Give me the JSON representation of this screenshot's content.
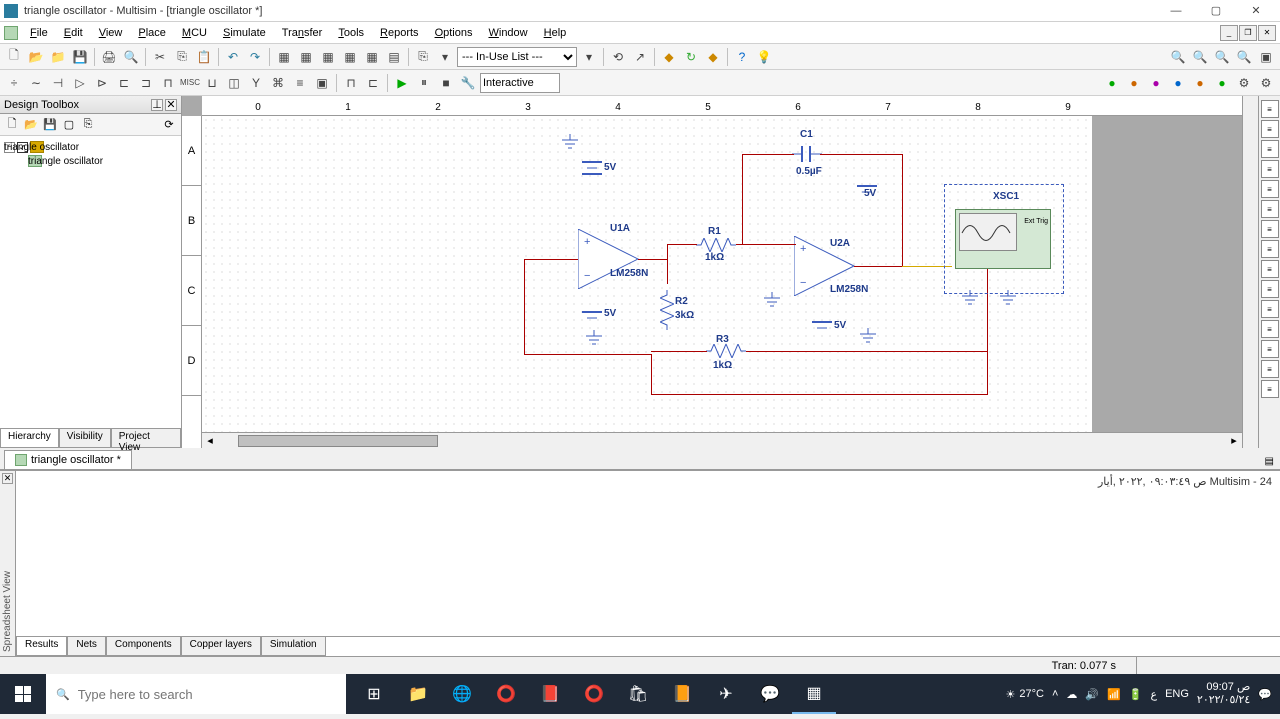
{
  "window": {
    "title": "triangle oscillator - Multisim - [triangle oscillator *]"
  },
  "menu": {
    "file": "File",
    "edit": "Edit",
    "view": "View",
    "place": "Place",
    "mcu": "MCU",
    "simulate": "Simulate",
    "transfer": "Transfer",
    "tools": "Tools",
    "reports": "Reports",
    "options": "Options",
    "window": "Window",
    "help": "Help"
  },
  "toolbar": {
    "inuse": "--- In-Use List ---",
    "interactive": "Interactive"
  },
  "designToolbox": {
    "title": "Design Toolbox",
    "root": "triangle oscillator",
    "child": "triangle oscillator"
  },
  "panelTabs": {
    "hierarchy": "Hierarchy",
    "visibility": "Visibility",
    "projectView": "Project View"
  },
  "ruler": {
    "rows": [
      "A",
      "B",
      "C",
      "D"
    ],
    "cols": [
      "0",
      "1",
      "2",
      "3",
      "4",
      "5",
      "6",
      "7",
      "8",
      "9"
    ]
  },
  "schematic": {
    "C1": {
      "ref": "C1",
      "val": "0.5µF"
    },
    "U1A": {
      "ref": "U1A",
      "val": "LM258N"
    },
    "U2A": {
      "ref": "U2A",
      "val": "LM258N"
    },
    "R1": {
      "ref": "R1",
      "val": "1kΩ"
    },
    "R2": {
      "ref": "R2",
      "val": "3kΩ"
    },
    "R3": {
      "ref": "R3",
      "val": "1kΩ"
    },
    "v5": "5V",
    "XSC1": "XSC1",
    "exttrig": "Ext Trig"
  },
  "docTab": "triangle oscillator *",
  "spreadsheet": {
    "msg": "Multisim  -  24 ص ٠٩:٠٣:٤٩ ,٢٠٢٢ ,أيار",
    "label": "Spreadsheet View"
  },
  "ssTabs": {
    "results": "Results",
    "nets": "Nets",
    "components": "Components",
    "copper": "Copper layers",
    "sim": "Simulation"
  },
  "status": {
    "tran": "Tran: 0.077 s"
  },
  "taskbar": {
    "search": "Type here to search",
    "weather": "27°C",
    "time": "09:07 ص",
    "date": "٢٠٢٢/٠٥/٢٤",
    "lang": "ع",
    "eng": "ENG"
  }
}
